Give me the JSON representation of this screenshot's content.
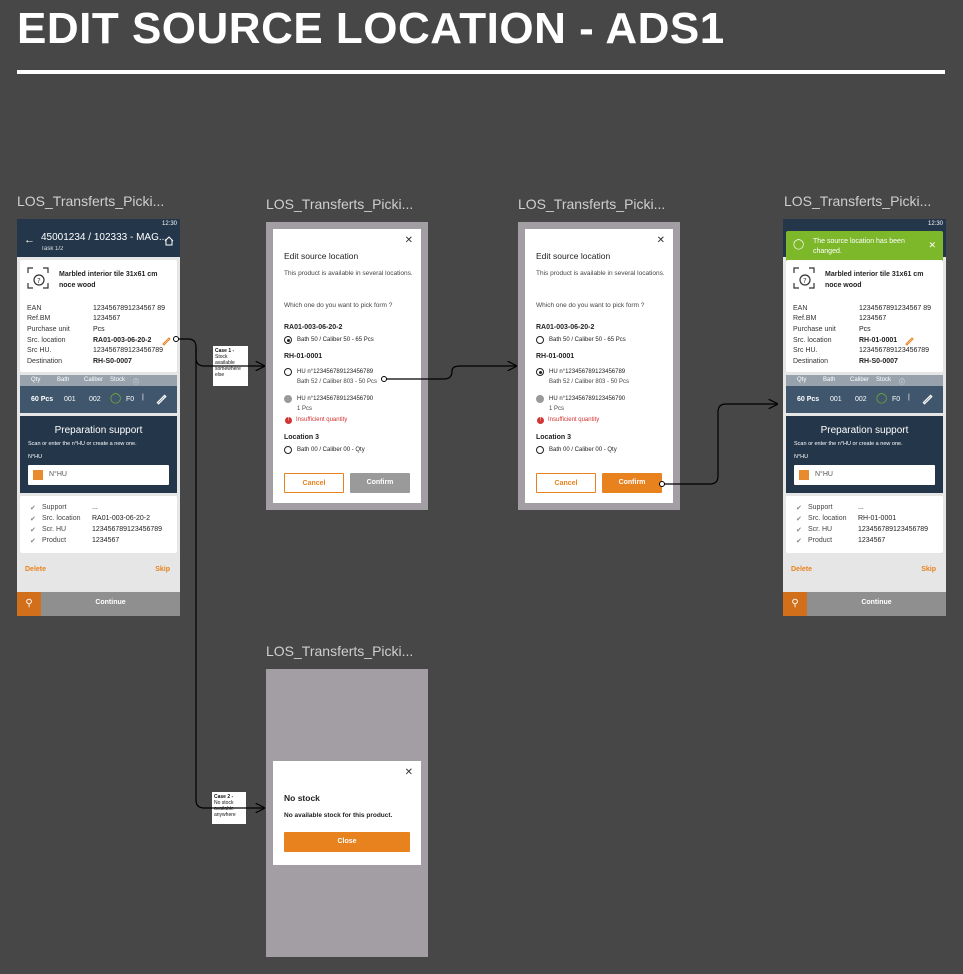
{
  "page": {
    "title": "EDIT SOURCE LOCATION - ADS1"
  },
  "frames": {
    "f1": "LOS_Transferts_Picki...",
    "f2": "LOS_Transferts_Picki...",
    "f3": "LOS_Transferts_Picki...",
    "f4": "LOS_Transferts_Picki...",
    "f5": "LOS_Transferts_Picki..."
  },
  "phone": {
    "time": "12:30",
    "title": "45001234 / 102333 - MAG...",
    "task": "Task 1/2",
    "product_name": "Marbled interior tile 31x61 cm noce wood",
    "labels": {
      "ean": "EAN",
      "ref": "Ref.BM",
      "unit": "Purchase unit",
      "src": "Src. location",
      "srchu": "Src HU.",
      "dest": "Destination"
    },
    "values": {
      "ean": "1234567891234567 89",
      "ref": "1234567",
      "unit": "Pcs",
      "dest": "RH-S0-0007",
      "srchu": "123456789123456789"
    },
    "qty_head": {
      "qty": "Qty",
      "bath": "Bath",
      "caliber": "Caliber",
      "stock": "Stock"
    },
    "qty_row": {
      "qty": "60 Pcs",
      "bath": "001",
      "caliber": "002",
      "stock": "F0"
    },
    "prep": {
      "title": "Preparation support",
      "desc": "Scan or enter the n°HU or create a new one.",
      "label": "N°HU",
      "placeholder": "N°HU"
    },
    "summary_labels": {
      "support": "Support",
      "src": "Src. location",
      "hu": "Scr. HU",
      "product": "Product"
    },
    "summary_values": {
      "support": "...",
      "hu": "123456789123456789",
      "product": "1234567"
    },
    "delete": "Delete",
    "skip": "Skip",
    "continue": "Continue"
  },
  "phone1": {
    "src_location": "RA01-003-06-20-2",
    "summary_src": "RA01-003-06-20-2"
  },
  "phone2": {
    "src_location": "RH-01-0001",
    "summary_src": "RH-01-0001",
    "toast": "The source location has been changed."
  },
  "modal": {
    "title": "Edit source location",
    "p1": "This product is available in several locations.",
    "p2": "Which one do you want to pick form ?",
    "loc1": "RA01-003-06-20-2",
    "loc1_opt": "Bath 50 / Caliber 50 - 65 Pcs",
    "loc2": "RH-01-0001",
    "hu1": "HU n°123456789123456789",
    "hu1_sub": "Bath 52 / Caliber 803 - 50 Pcs",
    "hu2": "HU n°123456789123456790",
    "hu2_sub": "1 Pcs",
    "warn": "Insufficient quantity",
    "loc3": "Location 3",
    "loc3_opt": "Bath 00 / Caliber 00 - Qty",
    "cancel": "Cancel",
    "confirm": "Confirm"
  },
  "nostock": {
    "title": "No stock",
    "text": "No available stock for this product.",
    "close": "Close"
  },
  "cases": {
    "case1_title": "Case 1 -",
    "case1_text": "Stock available somewhere else",
    "case2_title": "Case 2 -",
    "case2_text": "No stock available anywhere"
  },
  "colors": {
    "background": "#474747",
    "navy": "#24364a",
    "orange": "#e8821f",
    "success": "#7cb82a",
    "error": "#d23434"
  },
  "icons": [
    "product-scan-icon",
    "home-icon",
    "back-arrow-icon",
    "pencil-icon",
    "check-circle-icon",
    "close-icon",
    "barcode-icon",
    "cart-icon",
    "warning-icon"
  ]
}
